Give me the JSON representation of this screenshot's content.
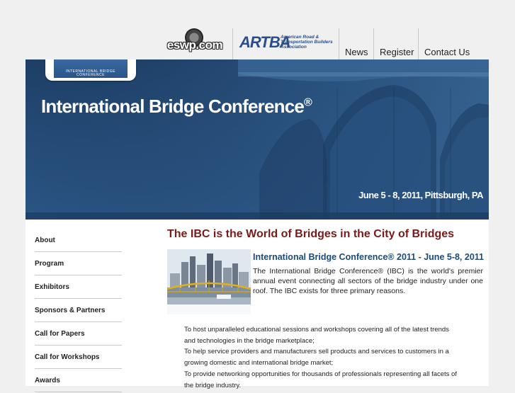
{
  "header": {
    "eswp_logo": "eswp.com",
    "artba_logo": {
      "mark": "ARTBA",
      "subtitle": "American Road & Transportation Builders Association"
    },
    "nav": [
      {
        "label": "News"
      },
      {
        "label": "Register"
      },
      {
        "label": "Contact Us"
      }
    ]
  },
  "banner": {
    "tab_logo": "INTERNATIONAL BRIDGE CONFERENCE",
    "title": "International Bridge Conference",
    "registered": "®",
    "date": "June 5 - 8, 2011, Pittsburgh, PA"
  },
  "sidebar": {
    "items": [
      {
        "label": "About"
      },
      {
        "label": "Program"
      },
      {
        "label": "Exhibitors"
      },
      {
        "label": "Sponsors & Partners"
      },
      {
        "label": "Call for Papers"
      },
      {
        "label": "Call for Workshops"
      },
      {
        "label": "Awards"
      }
    ]
  },
  "main": {
    "headline": "The IBC is the World of Bridges in the City of Bridges",
    "subheadline": "International Bridge Conference® 2011 - June 5-8, 2011",
    "intro": "The International Bridge Conference® (IBC) is the world's premier annual event connecting all sectors of the bridge industry under one roof. The IBC exists for three primary reasons.",
    "reasons": [
      "To host unparalleled educational sessions and workshops covering all of the latest trends",
      "and technologies in the bridge marketplace;",
      "To help service providers and manufacturers sell products and services to customers in a",
      "growing domestic and international bridge market;",
      "To provide networking opportunities for thousands of professionals representing all facets of",
      "the bridge industry."
    ]
  },
  "colors": {
    "banner_blue": "#244a75",
    "headline_red": "#7a1a1a",
    "subheadline_blue": "#1e4a7a",
    "page_bg": "#f0f0f0"
  }
}
